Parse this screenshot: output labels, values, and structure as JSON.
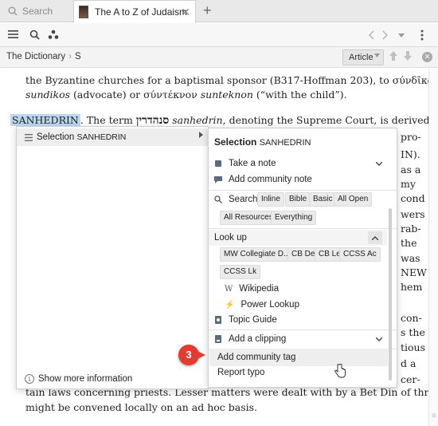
{
  "tabs": {
    "search_label": "Search",
    "active_title": "The A to Z of Judaism",
    "close_glyph": "✕",
    "add_glyph": "+"
  },
  "breadcrumb": {
    "items": [
      "The Dictionary",
      "S"
    ],
    "separator": "›"
  },
  "view_selector": {
    "label": "Article"
  },
  "article": {
    "line0": "the Byzantine churches for a baptismal sponsor (B317-Hoffman 203), to σύνδῖκος",
    "line1_a": "sundikos",
    "line1_b": " (advocate) or σύντέκνον ",
    "line1_c": "sunteknon",
    "line1_d": " (“with the child”).",
    "line2_hl": "SANHEDRIN",
    "line2_a": ". The term ",
    "line2_heb": "סנהדרין",
    "line2_b": " ",
    "line2_it": "sanhedrin",
    "line2_c": ", denoting the Supreme Court, is derived from",
    "right_frags": [
      "pro-",
      "IN).",
      "as a",
      "my",
      "cond",
      "wers",
      "rab-",
      "the",
      "was",
      "NEW",
      "hem",
      "con-",
      "s the",
      "tious",
      "d a",
      "cer-"
    ],
    "line_last1": "tain laws concerning priests. Lesser matters were dealt with by a Bet Din of three, which",
    "line_last2": "might be convened locally on an ad hoc basis."
  },
  "selection_menu": {
    "left_item_prefix": "Selection",
    "left_item_word": "SANHEDRIN",
    "show_more": "Show more information",
    "title_prefix": "Selection",
    "title_word": "SANHEDRIN",
    "take_note": "Take a note",
    "add_community_note": "Add community note",
    "search_label": "Search:",
    "search_chips": [
      "Inline",
      "Bible",
      "Basic",
      "All Open",
      "All Resources",
      "Everything"
    ],
    "look_up": "Look up",
    "lookup_chips": [
      "MW Collegiate D...",
      "CB De",
      "CB Le",
      "CCSS Ac",
      "CCSS Lk"
    ],
    "wikipedia": "Wikipedia",
    "power_lookup": "Power Lookup",
    "topic_guide": "Topic Guide",
    "add_clipping": "Add a clipping",
    "add_community_tag": "Add community tag",
    "report_typo": "Report typo"
  },
  "callout": {
    "number": "3",
    "color": "#e23b30"
  }
}
